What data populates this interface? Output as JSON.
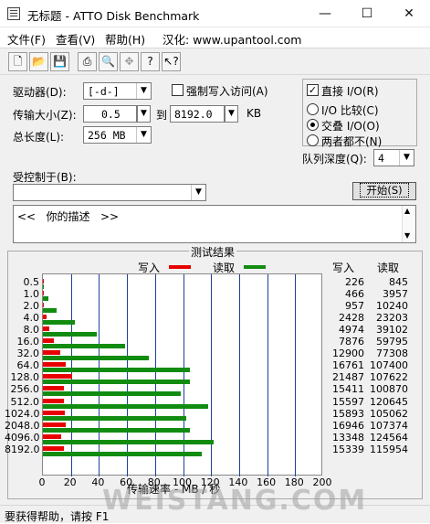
{
  "window": {
    "title": "无标题 - ATTO Disk Benchmark",
    "minimize": "—",
    "maximize": "☐",
    "close": "✕"
  },
  "menu": [
    "文件(F)",
    "查看(V)",
    "帮助(H)",
    "汉化: www.upantool.com"
  ],
  "toolbar": [
    {
      "icon": "new-document-icon",
      "glyph": "🗋"
    },
    {
      "icon": "open-folder-icon",
      "glyph": "📂"
    },
    {
      "icon": "save-icon",
      "glyph": "💾"
    },
    {
      "icon": "print-icon",
      "glyph": "⎙"
    },
    {
      "icon": "print-preview-icon",
      "glyph": "🔍"
    },
    {
      "icon": "move-icon",
      "glyph": "✥"
    },
    {
      "icon": "help-icon",
      "glyph": "?"
    },
    {
      "icon": "context-help-icon",
      "glyph": "↖?"
    }
  ],
  "settings": {
    "drive_label": "驱动器(D):",
    "drive_value": "[-d-]",
    "transfer_label": "传输大小(Z):",
    "transfer_from": "0.5",
    "to_label": "到",
    "transfer_to": "8192.0",
    "kb_label": "KB",
    "length_label": "总长度(L):",
    "length_value": "256 MB",
    "force_write_label": "强制写入访问(A)",
    "direct_io_label": "直接 I/O(R)",
    "io_compare_label": "I/O 比较(C)",
    "overlap_io_label": "交叠 I/O(O)",
    "neither_label": "两者都不(N)",
    "queue_label": "队列深度(Q):",
    "queue_value": "4",
    "controlled_by_label": "受控制于(B):",
    "controlled_by_value": "",
    "start_button": "开始(S)",
    "description": "<<   你的描述   >>"
  },
  "results": {
    "title": "测试结果",
    "legend_write": "写入",
    "legend_read": "读取",
    "col_write": "写入",
    "col_read": "读取",
    "xlabel": "传输速率 - MB / 秒"
  },
  "colors": {
    "write": "#e80000",
    "read": "#118c11",
    "grid": "#1f3fa0"
  },
  "chart_data": {
    "type": "bar",
    "orientation": "horizontal",
    "categories": [
      "0.5",
      "1.0",
      "2.0",
      "4.0",
      "8.0",
      "16.0",
      "32.0",
      "64.0",
      "128.0",
      "256.0",
      "512.0",
      "1024.0",
      "2048.0",
      "4096.0",
      "8192.0"
    ],
    "series": [
      {
        "name": "写入",
        "values": [
          0.22,
          0.46,
          0.93,
          2.37,
          4.86,
          7.69,
          12.6,
          16.37,
          20.98,
          15.05,
          15.23,
          15.52,
          16.55,
          13.04,
          14.98
        ]
      },
      {
        "name": "读取",
        "values": [
          0.83,
          3.86,
          10.0,
          22.66,
          38.19,
          58.39,
          75.47,
          104.9,
          105.1,
          98.51,
          117.7,
          102.6,
          104.9,
          121.6,
          113.2
        ]
      }
    ],
    "write_kb": [
      "226",
      "466",
      "957",
      "2428",
      "4974",
      "7876",
      "12900",
      "16761",
      "21487",
      "15411",
      "15597",
      "15893",
      "16946",
      "13348",
      "15339"
    ],
    "read_kb": [
      "845",
      "3957",
      "10240",
      "23203",
      "39102",
      "59795",
      "77308",
      "107400",
      "107622",
      "100870",
      "120645",
      "105062",
      "107374",
      "124564",
      "115954"
    ],
    "xticks": [
      "0",
      "20",
      "40",
      "60",
      "80",
      "100",
      "120",
      "140",
      "160",
      "180",
      "200"
    ],
    "xlim": [
      0,
      200
    ],
    "xlabel": "传输速率 - MB / 秒",
    "grid": true,
    "legend": "top"
  },
  "status": "要获得帮助，请按 F1",
  "watermark": "WEISTANG.COM"
}
